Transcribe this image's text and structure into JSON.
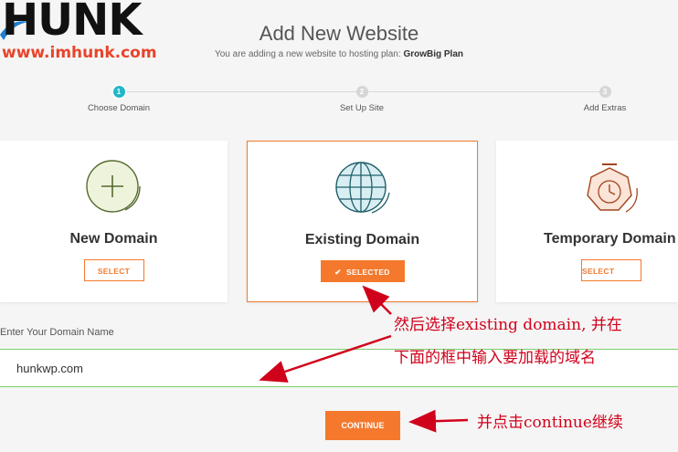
{
  "logo": {
    "main": "HUNK",
    "sub": "www.imhunk.com"
  },
  "header": {
    "title": "Add New Website",
    "subtitle_prefix": "You are adding a new website to hosting plan:",
    "plan_name": "GrowBig Plan"
  },
  "steps": [
    {
      "number": "1",
      "label": "Choose Domain",
      "active": true
    },
    {
      "number": "2",
      "label": "Set Up Site",
      "active": false
    },
    {
      "number": "3",
      "label": "Add Extras",
      "active": false
    }
  ],
  "cards": [
    {
      "name": "New Domain",
      "button": "SELECT",
      "icon": "plus-circle-icon",
      "selected": false
    },
    {
      "name": "Existing Domain",
      "button": "SELECTED",
      "icon": "globe-icon",
      "selected": true
    },
    {
      "name": "Temporary Domain",
      "button": "SELECT",
      "icon": "clock-icon",
      "selected": false
    }
  ],
  "domain_field": {
    "label": "Enter Your Domain Name",
    "value": "hunkwp.com"
  },
  "continue_label": "CONTINUE",
  "annotations": {
    "line1": "然后选择existing domain, 并在",
    "line2": "下面的框中输入要加载的域名",
    "line3": "并点击continue继续"
  },
  "colors": {
    "accent": "#f4792d",
    "step_active": "#22b8c9",
    "annotation": "#d0021b",
    "input_border": "#7ccf6b"
  }
}
